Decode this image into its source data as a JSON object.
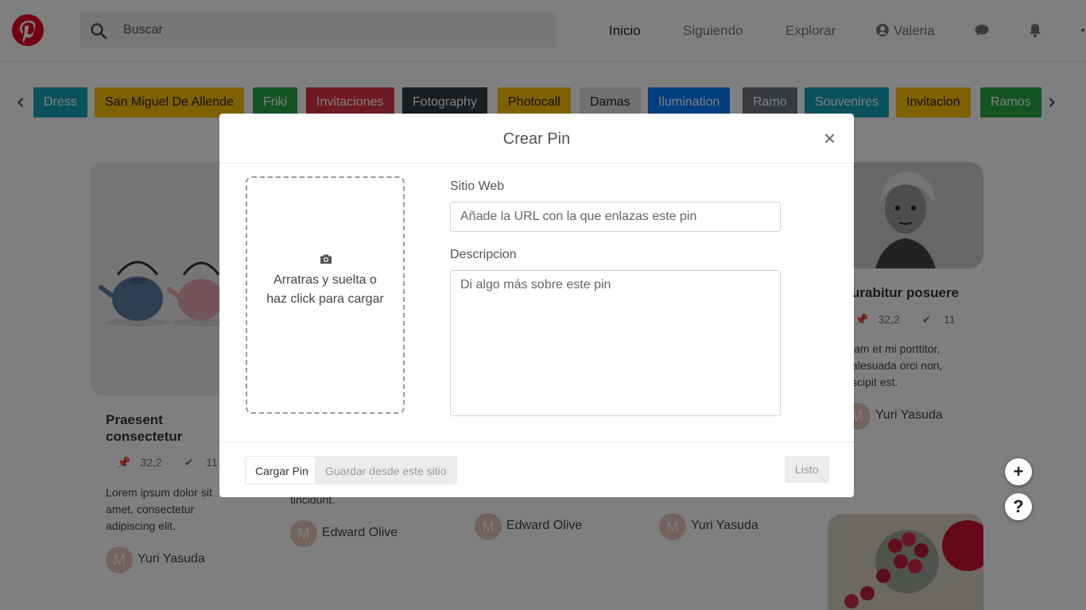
{
  "header": {
    "search_placeholder": "Buscar",
    "nav": {
      "inicio": "Inicio",
      "siguiendo": "Siguiendo",
      "explorar": "Explorar",
      "user": "Valeria"
    },
    "brand_color": "#e60023"
  },
  "categories": [
    {
      "label": "Dress",
      "color": "#17a2b8"
    },
    {
      "label": "San Miguel De Allende",
      "color": "#ffc107"
    },
    {
      "label": "Friki",
      "color": "#28a745"
    },
    {
      "label": "Invitaciones",
      "color": "#dc3545"
    },
    {
      "label": "Fotography",
      "color": "#343a40"
    },
    {
      "label": "Photocall",
      "color": "#ffc107"
    },
    {
      "label": "Damas",
      "color": "#e2e2e2"
    },
    {
      "label": "Ilumination",
      "color": "#007bff"
    },
    {
      "label": "Ramo",
      "color": "#6c757d"
    },
    {
      "label": "Souvenires",
      "color": "#17a2b8"
    },
    {
      "label": "Invitacion",
      "color": "#ffc107"
    },
    {
      "label": "Ramos",
      "color": "#28a745"
    }
  ],
  "cards": {
    "left": {
      "title": "Praesent consectetur",
      "pins": "32,2",
      "checks": "11",
      "text": "Lorem ipsum dolor sit amet, consectetur adipiscing elit.",
      "avatar": "M",
      "author": "Yuri Yasuda"
    },
    "right": {
      "title": "urabitur posuere",
      "pins": "32,2",
      "checks": "11",
      "text": "iam et mi porttitor, alesuada orci non, scipit est.",
      "avatar": "M",
      "author": "Yuri Yasuda"
    },
    "mid1": {
      "text": "tincidunt.",
      "avatar": "M",
      "author": "Edward Olive"
    },
    "mid2": {
      "avatar": "M",
      "author": "Edward Olive"
    },
    "mid3": {
      "avatar": "M",
      "author": "Yuri Yasuda"
    }
  },
  "fab": {
    "add": "+",
    "help": "?"
  },
  "modal": {
    "title": "Crear Pin",
    "close": "×",
    "dropzone_text": "Arratras y suelta o haz click para cargar",
    "website_label": "Sitio Web",
    "website_placeholder": "Añade la URL con la que enlazas este pin",
    "description_label": "Descripcion",
    "description_placeholder": "Di algo más sobre este pin",
    "tab_upload": "Cargar Pin",
    "tab_save_from_site": "Guardar desde este sitio",
    "done": "Listo"
  }
}
